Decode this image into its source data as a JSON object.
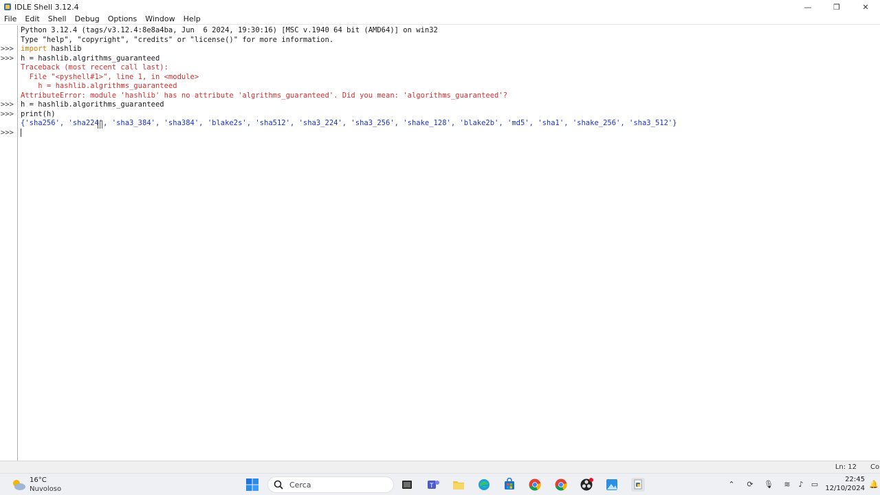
{
  "window": {
    "title": "IDLE Shell 3.12.4",
    "minimize_glyph": "—",
    "maximize_glyph": "❐",
    "close_glyph": "✕"
  },
  "menu": [
    "File",
    "Edit",
    "Shell",
    "Debug",
    "Options",
    "Window",
    "Help"
  ],
  "shell": {
    "prompts": [
      ">>>",
      ">>>",
      ">>>",
      ">>>",
      ">>>"
    ],
    "lines": {
      "l1": "Python 3.12.4 (tags/v3.12.4:8e8a4ba, Jun  6 2024, 19:30:16) [MSC v.1940 64 bit (AMD64)] on win32",
      "l2": "Type \"help\", \"copyright\", \"credits\" or \"license()\" for more information.",
      "l3_kw": "import",
      "l3_rest": " hashlib",
      "l4": "h = hashlib.algrithms_guaranteed",
      "l5": "Traceback (most recent call last):",
      "l6": "  File \"<pyshell#1>\", line 1, in <module>",
      "l7": "    h = hashlib.algrithms_guaranteed",
      "l8": "AttributeError: module 'hashlib' has no attribute 'algrithms_guaranteed'. Did you mean: 'algorithms_guaranteed'?",
      "l9": "h = hashlib.algorithms_guaranteed",
      "l10": "print(h)",
      "l11": "{'sha256', 'sha224', 'sha3_384', 'sha384', 'blake2s', 'sha512', 'sha3_224', 'sha3_256', 'shake_128', 'blake2b', 'md5', 'sha1', 'shake_256', 'sha3_512'}"
    }
  },
  "status": {
    "ln": "Ln: 12",
    "col": "Col"
  },
  "taskbar": {
    "temperature": "16°C",
    "weather": "Nuvoloso",
    "search_label": "Cerca",
    "time": "22:45",
    "date": "12/10/2024"
  },
  "colors": {
    "keyword": "#e07a00",
    "error": "#d23030",
    "stdout": "#1a33c8"
  }
}
